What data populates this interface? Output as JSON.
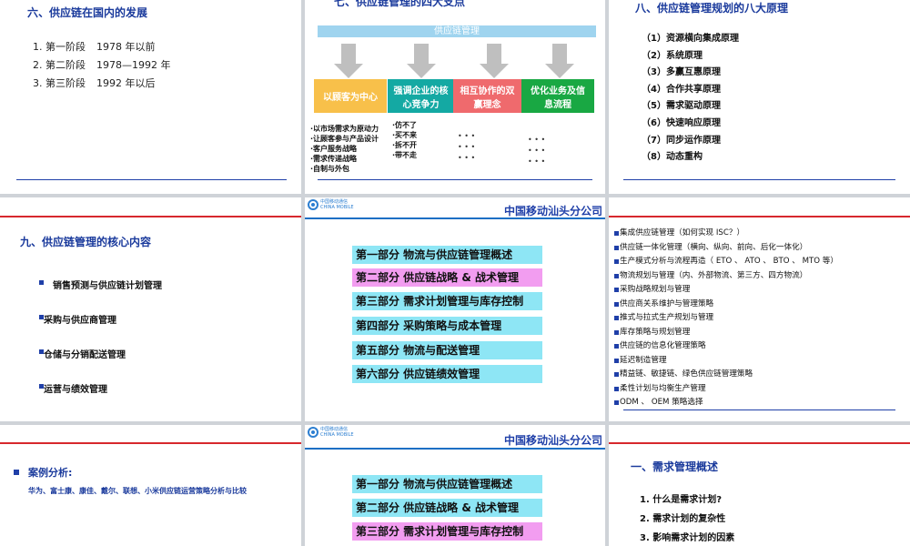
{
  "slide1": {
    "title": "六、供应链在国内的发展",
    "items": [
      {
        "num": "1.",
        "stage": "第一阶段",
        "period": "1978 年以前"
      },
      {
        "num": "2.",
        "stage": "第二阶段",
        "period": "1978—1992 年"
      },
      {
        "num": "3.",
        "stage": "第三阶段",
        "period": "1992 年以后"
      }
    ]
  },
  "slide2": {
    "title": "七、供应链管理的四大支点",
    "bar_label": "供应链管理",
    "boxes": [
      {
        "label": "以顾客为中心",
        "color": "#f8c04a"
      },
      {
        "label": "强调企业的核心竞争力",
        "color": "#14a9a3"
      },
      {
        "label": "相互协作的双赢理念",
        "color": "#ef6a6d"
      },
      {
        "label": "优化业务及信息流程",
        "color": "#19a843"
      }
    ],
    "col1": [
      "·以市场需求为原动力",
      "·让顾客参与产品设计",
      "·客户服务战略",
      "·需求传递战略",
      "·自制与外包"
    ],
    "col2": [
      "·仿不了",
      "·买不来",
      "·拆不开",
      "·带不走"
    ],
    "dots": "• • •"
  },
  "slide3": {
    "title": "八、供应链管理规划的八大原理",
    "items": [
      "（1）资源横向集成原理",
      "（2）系统原理",
      "（3）多赢互惠原理",
      "（4）合作共享原理",
      "（5）需求驱动原理",
      "（6）快速响应原理",
      "（7）同步运作原理",
      "（8）动态重构"
    ]
  },
  "slide4": {
    "title": "九、供应链管理的核心内容",
    "items": [
      "销售预测与供应链计划管理",
      "采购与供应商管理",
      "仓储与分销配送管理",
      "运营与绩效管理"
    ]
  },
  "slide5": {
    "logo_cn": "中国移动通信",
    "logo_en": "CHINA MOBILE",
    "company": "中国移动汕头分公司",
    "parts": [
      {
        "label": "第一部分 物流与供应链管理概述",
        "highlight": false
      },
      {
        "label": "第二部分 供应链战略 & 战术管理",
        "highlight": true
      },
      {
        "label": "第三部分 需求计划管理与库存控制",
        "highlight": false
      },
      {
        "label": "第四部分 采购策略与成本管理",
        "highlight": false
      },
      {
        "label": "第五部分 物流与配送管理",
        "highlight": false
      },
      {
        "label": "第六部分 供应链绩效管理",
        "highlight": false
      }
    ]
  },
  "slide6": {
    "items": [
      "集成供应链管理（如何实现 ISC？）",
      "供应链一体化管理（横向、纵向、前向、后化一体化）",
      "生产模式分析与流程再造（ ETO 、 ATO 、 BTO 、 MTO 等）",
      "物流规划与管理（内、外部物流、第三方、四方物流）",
      "采购战略规划与管理",
      "供应商关系维护与管理策略",
      "推式与拉式生产规划与管理",
      "库存策略与规划管理",
      "供应链的信息化管理策略",
      "延迟制造管理",
      "精益链、敏捷链、绿色供应链管理策略",
      "柔性计划与均衡生产管理",
      "ODM 、 OEM 策略选择"
    ]
  },
  "slide7": {
    "heading": "案例分析:",
    "subtitle": "华为、富士康、康佳、戴尔、联想、小米供应链运营策略分析与比较"
  },
  "slide8": {
    "logo_cn": "中国移动通信",
    "logo_en": "CHINA MOBILE",
    "company": "中国移动汕头分公司",
    "parts": [
      {
        "label": "第一部分 物流与供应链管理概述",
        "highlight": false
      },
      {
        "label": "第二部分 供应链战略 & 战术管理",
        "highlight": false
      },
      {
        "label": "第三部分 需求计划管理与库存控制",
        "highlight": true
      }
    ]
  },
  "slide9": {
    "title": "一、需求管理概述",
    "items": [
      "1. 什么是需求计划?",
      "2. 需求计划的复杂性",
      "3. 影响需求计划的因素"
    ]
  }
}
